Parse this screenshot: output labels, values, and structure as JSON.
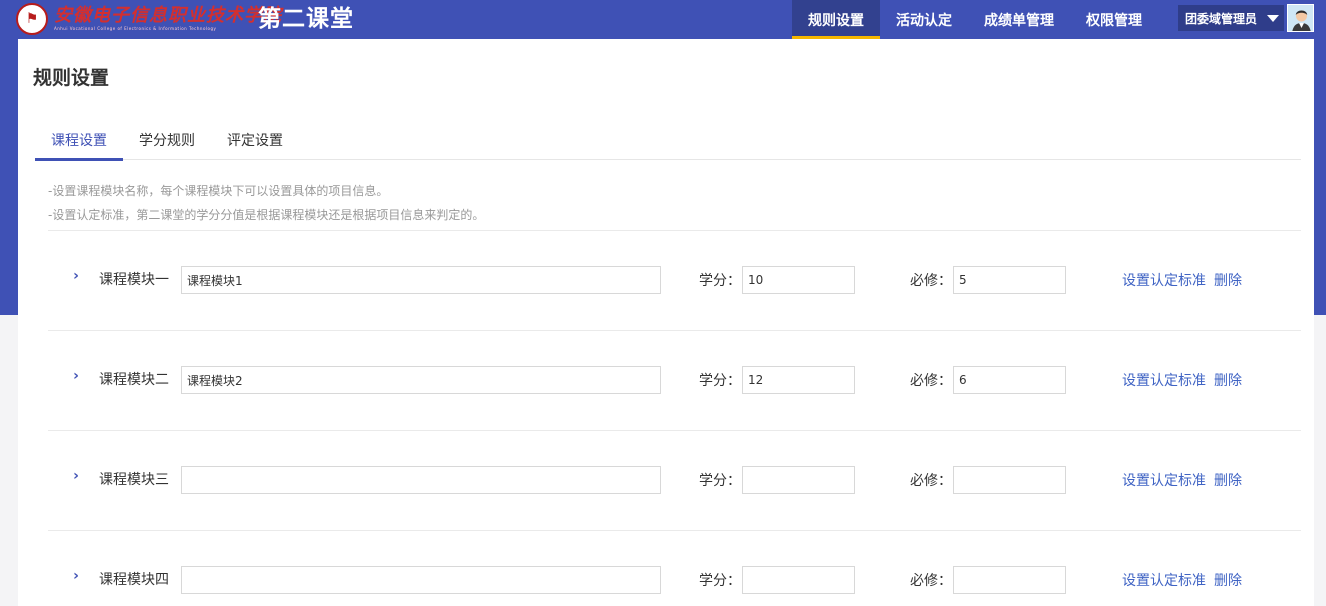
{
  "header": {
    "logo_cn": "安徽电子信息职业技术学院",
    "logo_en": "Anhui Vocational College of Electronics & Information Technology",
    "app_title": "第二课堂",
    "nav": [
      "规则设置",
      "活动认定",
      "成绩单管理",
      "权限管理"
    ],
    "active_nav": "规则设置",
    "user_name": "团委域管理员"
  },
  "page": {
    "title": "规则设置",
    "tabs": [
      "课程设置",
      "学分规则",
      "评定设置"
    ],
    "active_tab": "课程设置",
    "tips": [
      "-设置课程模块名称，每个课程模块下可以设置具体的项目信息。",
      "-设置认定标准，第二课堂的学分分值是根据课程模块还是根据项目信息来判定的。"
    ]
  },
  "labels": {
    "credit": "学分：",
    "required": "必修：",
    "set_standard": "设置认定标准",
    "delete": "删除"
  },
  "modules": [
    {
      "label": "课程模块一",
      "name": "课程模块1",
      "credit": "10",
      "required": "5"
    },
    {
      "label": "课程模块二",
      "name": "课程模块2",
      "credit": "12",
      "required": "6"
    },
    {
      "label": "课程模块三",
      "name": "",
      "credit": "",
      "required": ""
    },
    {
      "label": "课程模块四",
      "name": "",
      "credit": "",
      "required": ""
    }
  ],
  "colors": {
    "brand": "#3f51b5",
    "nav_active_underline": "#f5b700",
    "link": "#3f63c4"
  }
}
